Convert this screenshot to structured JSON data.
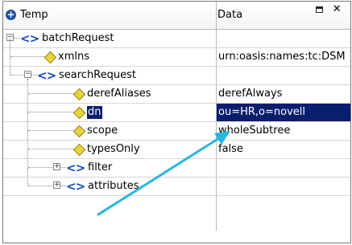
{
  "header": {
    "col_tree": "Temp",
    "col_data": "Data",
    "restore_icon": "restore-icon",
    "close_icon": "close-icon"
  },
  "rows": [
    {
      "label": "batchRequest",
      "value": "",
      "type": "element",
      "expander": "minus",
      "selected": false
    },
    {
      "label": "xmlns",
      "value": "urn:oasis:names:tc:DSM",
      "type": "attribute",
      "selected": false
    },
    {
      "label": "searchRequest",
      "value": "",
      "type": "element",
      "expander": "minus",
      "selected": false
    },
    {
      "label": "derefAliases",
      "value": "derefAlways",
      "type": "attribute",
      "selected": false
    },
    {
      "label": "dn",
      "value": "ou=HR,o=novell",
      "type": "attribute",
      "selected": true
    },
    {
      "label": "scope",
      "value": "wholeSubtree",
      "type": "attribute",
      "selected": false
    },
    {
      "label": "typesOnly",
      "value": "false",
      "type": "attribute",
      "selected": false
    },
    {
      "label": "filter",
      "value": "",
      "type": "element",
      "expander": "plus",
      "selected": false
    },
    {
      "label": "attributes",
      "value": "",
      "type": "element",
      "expander": "plus",
      "selected": false
    }
  ],
  "colors": {
    "selection": "#0a1e6e",
    "arrow": "#29b6e0",
    "tag": "#1248b9",
    "attribute_diamond": "#e8d33a"
  }
}
